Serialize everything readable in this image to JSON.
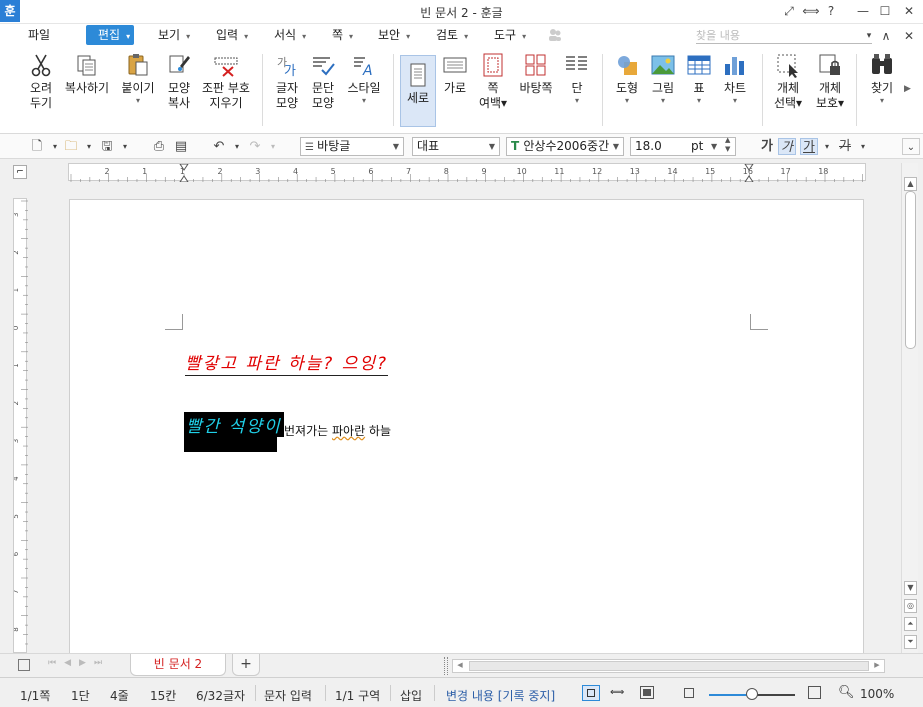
{
  "window": {
    "app_icon": "훈",
    "title": "빈 문서 2 - 훈글",
    "buttons": [
      "⤢",
      "⟺",
      "?",
      "—",
      "☐",
      "✕"
    ]
  },
  "menu": {
    "items": [
      {
        "label": "파일",
        "arrow": ""
      },
      {
        "label": "편집",
        "arrow": "▾"
      },
      {
        "label": "보기",
        "arrow": "▾"
      },
      {
        "label": "입력",
        "arrow": "▾"
      },
      {
        "label": "서식",
        "arrow": "▾"
      },
      {
        "label": "쪽",
        "arrow": "▾"
      },
      {
        "label": "보안",
        "arrow": "▾"
      },
      {
        "label": "검토",
        "arrow": "▾"
      },
      {
        "label": "도구",
        "arrow": "▾"
      }
    ],
    "find_placeholder": "찾을 내용",
    "right_controls": [
      "▾",
      "∧",
      "✕"
    ]
  },
  "ribbon": {
    "buttons": [
      {
        "line1": "오려",
        "line2": "두기",
        "icon": "scissors-icon"
      },
      {
        "line1": "복사하기",
        "line2": "",
        "icon": "copy-icon"
      },
      {
        "line1": "붙이기",
        "line2": "▾",
        "icon": "paste-icon"
      },
      {
        "line1": "모양",
        "line2": "복사",
        "icon": "format-painter-icon"
      },
      {
        "line1": "조판 부호",
        "line2": "지우기",
        "icon": "clear-marks-icon"
      },
      {
        "line1": "글자",
        "line2": "모양",
        "icon": "char-shape-icon"
      },
      {
        "line1": "문단",
        "line2": "모양",
        "icon": "para-shape-icon"
      },
      {
        "line1": "스타일",
        "line2": "▾",
        "icon": "style-icon"
      },
      {
        "line1": "세로",
        "line2": "",
        "icon": "portrait-icon"
      },
      {
        "line1": "가로",
        "line2": "",
        "icon": "landscape-icon"
      },
      {
        "line1": "쪽",
        "line2": "여백▾",
        "icon": "margin-icon"
      },
      {
        "line1": "바탕쪽",
        "line2": "",
        "icon": "master-page-icon"
      },
      {
        "line1": "단",
        "line2": "▾",
        "icon": "columns-icon"
      },
      {
        "line1": "도형",
        "line2": "▾",
        "icon": "shapes-icon"
      },
      {
        "line1": "그림",
        "line2": "▾",
        "icon": "picture-icon"
      },
      {
        "line1": "표",
        "line2": "▾",
        "icon": "table-icon"
      },
      {
        "line1": "차트",
        "line2": "▾",
        "icon": "chart-icon"
      },
      {
        "line1": "개체",
        "line2": "선택▾",
        "icon": "select-object-icon"
      },
      {
        "line1": "개체",
        "line2": "보호▾",
        "icon": "protect-object-icon"
      },
      {
        "line1": "찾기",
        "line2": "▾",
        "icon": "binoculars-icon"
      }
    ]
  },
  "toolbar": {
    "style_value": "바탕글",
    "lang_value": "대표",
    "font_value": "안상수2006중간",
    "size_value": "18.0",
    "size_unit": "pt",
    "bold_glyph": "가",
    "italic_glyph": "가",
    "underline_glyph": "가",
    "strike_glyph": "가"
  },
  "ruler": {
    "h_ticks": [
      "2",
      "1",
      "1",
      "2",
      "3",
      "4",
      "5",
      "6",
      "7",
      "8",
      "9",
      "10",
      "11",
      "12",
      "13",
      "14",
      "15",
      "16",
      "17",
      "18"
    ],
    "v_ticks": [
      "3",
      "2",
      "1",
      "0",
      "1",
      "2",
      "3",
      "4",
      "5",
      "6",
      "7",
      "8"
    ]
  },
  "document": {
    "line1": "빨갛고 파란 하늘? 으잉?",
    "line2_highlight": "빨간 석양이",
    "line2_rest_a": "번져가는 ",
    "line2_squiggle": "파아란",
    "line2_rest_b": " 하늘"
  },
  "tabs": {
    "doc_tab": "빈 문서 2",
    "add_tab": "+"
  },
  "status": {
    "page": "1/1쪽",
    "column": "1단",
    "line": "4줄",
    "col": "15칸",
    "chars": "6/32글자",
    "input_mode": "문자 입력",
    "section": "1/1 구역",
    "insert": "삽입",
    "track": "변경 내용 [기록 중지]",
    "zoom": "100%",
    "zoom_fraction": 0.5
  }
}
